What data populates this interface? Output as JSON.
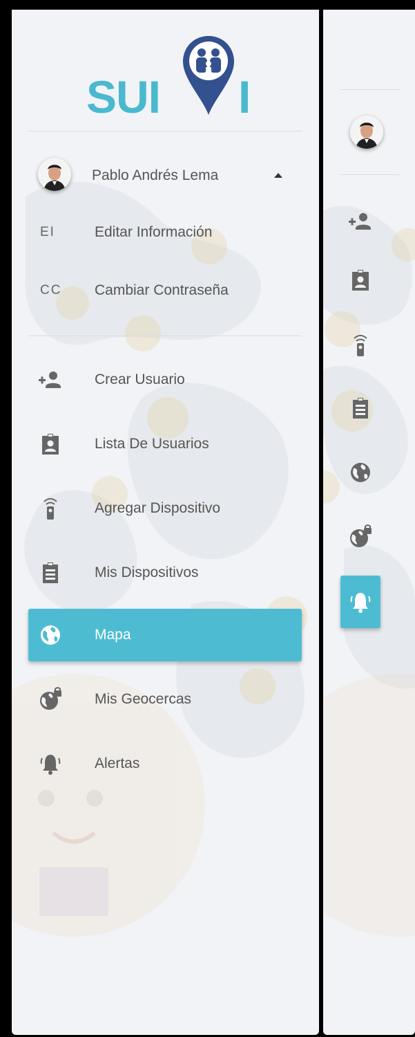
{
  "app": {
    "logo_text": "SUI",
    "logo_text_tail": "I"
  },
  "user": {
    "name": "Pablo Andrés Lema"
  },
  "account_menu": [
    {
      "abbr": "EI",
      "label": "Editar Información"
    },
    {
      "abbr": "CC",
      "label": "Cambiar Contraseña"
    }
  ],
  "nav": [
    {
      "label": "Crear Usuario",
      "icon": "add-user-icon"
    },
    {
      "label": "Lista De Usuarios",
      "icon": "user-badge-icon"
    },
    {
      "label": "Agregar Dispositivo",
      "icon": "remote-device-icon"
    },
    {
      "label": "Mis Dispositivos",
      "icon": "clipboard-icon"
    },
    {
      "label": "Mapa",
      "icon": "globe-icon",
      "active": true
    },
    {
      "label": "Mis Geocercas",
      "icon": "globe-lock-icon"
    },
    {
      "label": "Alertas",
      "icon": "bell-icon"
    }
  ],
  "colors": {
    "accent": "#4dbcd2",
    "logo": "#4ab9cf",
    "pin": "#33508f",
    "icon": "#666666"
  }
}
